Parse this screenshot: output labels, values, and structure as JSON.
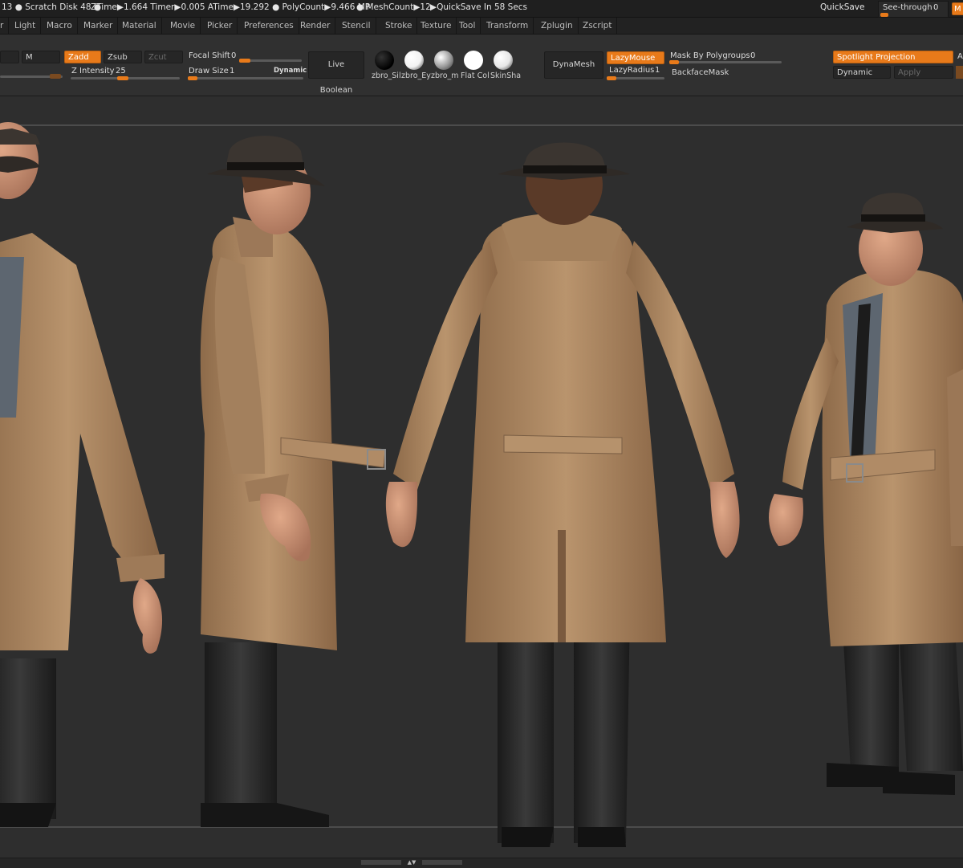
{
  "status_bar": {
    "scratch": "13 ● Scratch Disk 48 ●",
    "ztime": "ZTime▶1.664 Timer▶0.005 ATime▶19.292 ● PolyCount▶9.466 MP",
    "mesh": "● MeshCount▶12",
    "autosave": "▶QuickSave In 58 Secs",
    "quicksave": "QuickSave",
    "seethrough_label": "See-through",
    "seethrough_value": "0",
    "menus_button": "M",
    "accent": "#e87a1a"
  },
  "menu_items": [
    "r",
    "Light",
    "Macro",
    "Marker",
    "Material",
    "Movie",
    "Picker",
    "Preferences",
    "Render",
    "Stencil",
    "Stroke",
    "Texture",
    "Tool",
    "Transform",
    "Zplugin",
    "Zscript"
  ],
  "toolbar": {
    "m_label": "M",
    "zadd": "Zadd",
    "zsub": "Zsub",
    "zcut": "Zcut",
    "focal_shift_label": "Focal Shift",
    "focal_shift_value": "0",
    "z_intensity_label": "Z Intensity",
    "z_intensity_value": "25",
    "draw_size_label": "Draw Size",
    "draw_size_value": "1",
    "dynamic_label": "Dynamic",
    "live_boolean": "Live Boolean",
    "materials": [
      {
        "name": "zbro_Sil",
        "icon": "black-sphere-icon",
        "color": "#050505"
      },
      {
        "name": "zbro_Ey",
        "icon": "white-sphere-icon",
        "color": "#f2f2f2"
      },
      {
        "name": "zbro_m",
        "icon": "gray-sphere-icon",
        "color": "#9a9a9a"
      },
      {
        "name": "Flat Col",
        "icon": "flat-white-sphere-icon",
        "color": "#ffffff"
      },
      {
        "name": "SkinSha",
        "icon": "shaded-sphere-icon",
        "color": "#e6e6e6"
      }
    ],
    "dynamesh": "DynaMesh",
    "lazymouse": "LazyMouse",
    "lazyradius_label": "LazyRadius",
    "lazyradius_value": "1",
    "mask_polygroups_label": "Mask By Polygroups",
    "mask_polygroups_value": "0",
    "backface_mask": "BackfaceMask",
    "spotlight_projection": "Spotlight Projection",
    "dynamic_btn": "Dynamic",
    "apply_btn": "Apply",
    "cut_letter": "A"
  },
  "viewport": {
    "subject": "trench-coat-character-turnaround",
    "coat_color": "#b38e68",
    "hat_color": "#3b3530",
    "pants_color": "#232323",
    "skin_color": "#c89274",
    "background_color": "#2e2e2e"
  }
}
